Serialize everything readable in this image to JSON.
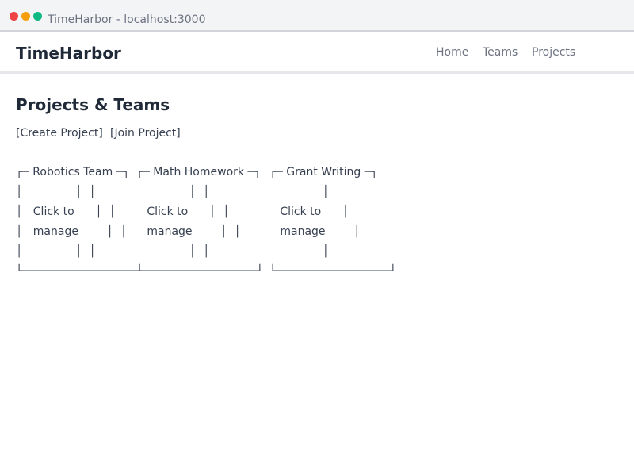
{
  "window": {
    "title": "TimeHarbor - localhost:3000"
  },
  "navbar": {
    "brand": "TimeHarbor",
    "links": [
      "Home",
      "Teams",
      "Projects"
    ]
  },
  "page": {
    "heading": "Projects & Teams",
    "actions": {
      "create": "[Create Project]",
      "join": "[Join Project]"
    }
  },
  "cards": [
    {
      "lines": [
        "┌─ Robotics Team ─┐",
        "│               │  │",
        "│   Click to      │  │",
        "│   manage        │  │",
        "│               │  │",
        "└─────────────────┘"
      ]
    },
    {
      "lines": [
        "┌─ Math Homework ─┐",
        "               │  │",
        "   Click to      │  │",
        "   manage        │  │",
        "               │  │",
        "└─────────────────┘"
      ]
    },
    {
      "lines": [
        "┌─ Grant Writing ─┐",
        "               │",
        "   Click to      │",
        "   manage        │",
        "               │",
        "└─────────────────┘"
      ]
    }
  ],
  "colors": {
    "titlebar_bg": "#f3f4f6",
    "close": "#ef4444",
    "minimize": "#f59e0b",
    "maximize": "#10b981",
    "text_dark": "#1f2937",
    "text_muted": "#6b7280"
  }
}
